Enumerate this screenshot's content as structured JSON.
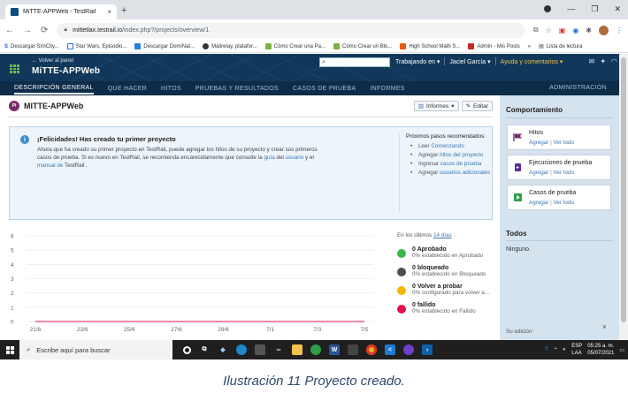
{
  "browser": {
    "tab_title": "MiTTE-APPWeb - TestRail",
    "new_tab": "+",
    "tab_close": "×",
    "url_host": "mittetlax.testrail.io",
    "url_path": "/index.php?/projects/overview/1",
    "bookmarks": [
      "Descargar SimCity...",
      "Star Wars, Episodio...",
      "Descargar DomiNat...",
      "Mailrelay, platafor...",
      "Cómo Crear una Pa...",
      "Cómo Crear un Blo...",
      "High School Math S...",
      "Admin - Mis Posts"
    ],
    "bookmarks_more": "»",
    "reading_list": "Lista de lectura"
  },
  "header": {
    "back_label": "← Volver al panel",
    "project_name": "MiTTE-APPWeb",
    "working_in": "Trabajando en ▾",
    "user": "Jaciel García ▾",
    "help": "Ayuda y comentarios ▾"
  },
  "nav": {
    "items": [
      "DESCRIPCIÓN GENERAL",
      "QUE HACER",
      "HITOS",
      "PRUEBAS Y RESULTADOS",
      "CASOS DE PRUEBA",
      "INFORMES"
    ],
    "admin": "ADMINISTRACIÓN"
  },
  "main": {
    "badge": "PI",
    "title": "MITTE-APPWeb",
    "reports_btn": "Informes",
    "edit_btn": "Editar"
  },
  "info": {
    "title": "¡Felicidades! Has creado tu primer proyecto",
    "text_a": "Ahora que ha creado su primer proyecto en TestRail, puede agregar los hitos de su proyecto y crear sus primeros casos de prueba. Si es nuevo en TestRail, se recomienda encarecidamente que consulte la ",
    "link_guide": "guía",
    "text_b": " del ",
    "link_user": "usuario",
    "text_c": " y el ",
    "link_manual": "manual de",
    "text_d": " TestRail .",
    "next_title": "Próximos pasos recomendados:",
    "steps": [
      {
        "pre": "Leer ",
        "link": "Comenzando"
      },
      {
        "pre": "Agregar ",
        "link": "hitos del proyecto"
      },
      {
        "pre": "Ingresar ",
        "link": "casos de prueba"
      },
      {
        "pre": "Agregar ",
        "link": "usuarios adicionales"
      }
    ]
  },
  "legend": {
    "head": "En los últimos ",
    "head_link": "14 días",
    "head_tail": " :",
    "items": [
      {
        "count": "0 Aprobado",
        "desc": "0% establecido en Aprobado",
        "color": "#3cb64a"
      },
      {
        "count": "0 bloqueado",
        "desc": "0% establecido en Bloqueado",
        "color": "#4d4d4d"
      },
      {
        "count": "0 Volver a probar",
        "desc": "0% configurado para volver a...",
        "color": "#f5b400"
      },
      {
        "count": "0 fallido",
        "desc": "0% establecido en Fallido",
        "color": "#e0134b"
      }
    ]
  },
  "chart_data": {
    "type": "line",
    "categories": [
      "21/6",
      "23/6",
      "25/6",
      "27/6",
      "29/6",
      "7/1",
      "7/3",
      "7/5"
    ],
    "yticks": [
      0,
      1,
      2,
      3,
      4,
      5,
      6
    ],
    "ylim": [
      0,
      6
    ],
    "series": [
      {
        "name": "Aprobado",
        "values": [
          0,
          0,
          0,
          0,
          0,
          0,
          0,
          0
        ],
        "color": "#3cb64a"
      },
      {
        "name": "Fallido",
        "values": [
          0,
          0,
          0,
          0,
          0,
          0,
          0,
          0
        ],
        "color": "#e0134b"
      }
    ],
    "grid": true
  },
  "sidebar": {
    "title": "Comportamiento",
    "cards": [
      {
        "name": "Hitos",
        "add": "Agregar",
        "view": "Ver todo",
        "icon": "flag-icon"
      },
      {
        "name": "Ejecuciones de prueba",
        "add": "Agregar",
        "view": "Ver todo",
        "icon": "test-run-icon"
      },
      {
        "name": "Casos de prueba",
        "add": "Agregar",
        "view": "Ver todo",
        "icon": "test-case-icon"
      }
    ],
    "todos_title": "Todos",
    "todos_value": "Ninguno.",
    "subscription": "Su edición:",
    "close": "×"
  },
  "taskbar": {
    "search_placeholder": "Escribe aquí para buscar",
    "lang1": "ESP",
    "lang2": "LAA",
    "time": "05:25 a. m.",
    "date": "05/07/2021"
  },
  "caption": "Ilustración 11 Proyecto creado."
}
